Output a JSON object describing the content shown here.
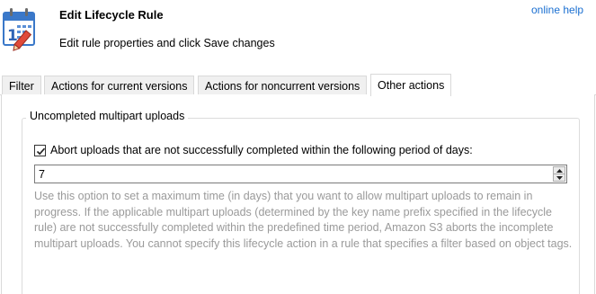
{
  "dialog": {
    "title": "Edit Lifecycle Rule",
    "subtitle": "Edit rule properties and click Save changes",
    "help_link": "online help",
    "icon": "calendar-edit-icon"
  },
  "tabs": [
    {
      "label": "Filter",
      "active": false
    },
    {
      "label": "Actions for current versions",
      "active": false
    },
    {
      "label": "Actions for noncurrent versions",
      "active": false
    },
    {
      "label": "Other actions",
      "active": true
    }
  ],
  "multipart": {
    "group_title": "Uncompleted multipart uploads",
    "checkbox_label": "Abort uploads that are not successfully completed within the following period of days:",
    "checked": true,
    "days_value": "7",
    "help_text": "Use this option to set a maximum time (in days) that you want to allow multipart uploads to remain in progress. If the applicable multipart uploads (determined by the key name prefix specified in the lifecycle rule) are not successfully completed within the predefined time period, Amazon S3 aborts the incomplete multipart uploads. You cannot specify this lifecycle action in a rule that specifies a filter based on object tags."
  },
  "colors": {
    "link": "#1a6fd1",
    "help_text": "#9a9a9a",
    "border": "#d9d9d9"
  }
}
